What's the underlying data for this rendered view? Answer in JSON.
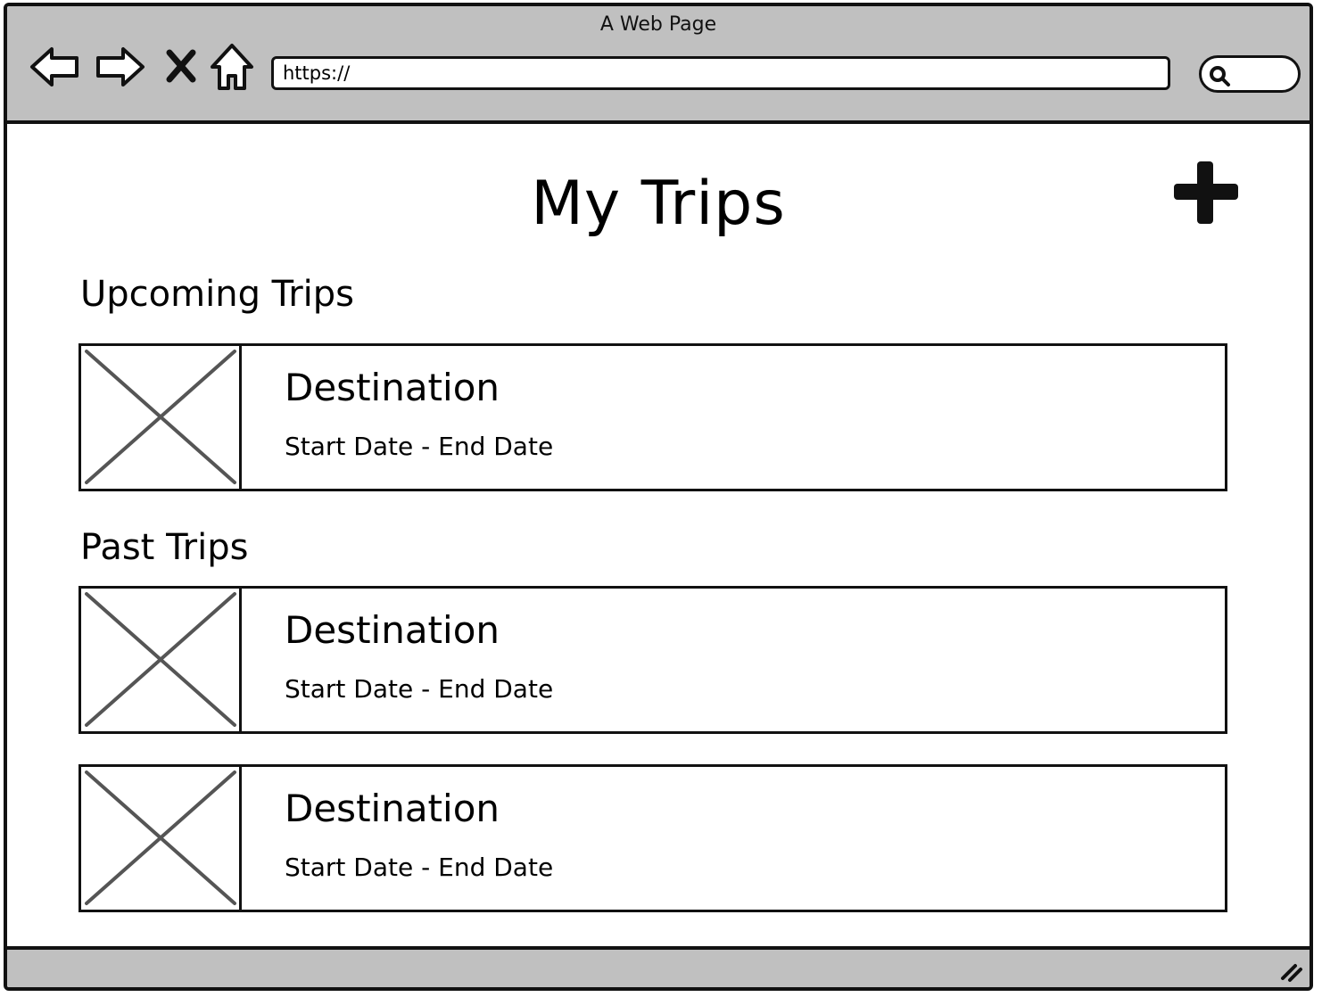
{
  "window": {
    "title": "A Web Page"
  },
  "browser": {
    "url": "https://",
    "icons": [
      "back-icon",
      "forward-icon",
      "close-icon",
      "home-icon",
      "search-icon"
    ]
  },
  "page": {
    "title": "My Trips",
    "add_icon": "plus-icon"
  },
  "sections": {
    "upcoming": {
      "heading": "Upcoming Trips",
      "trips": [
        {
          "destination": "Destination",
          "dates": "Start Date - End Date"
        }
      ]
    },
    "past": {
      "heading": "Past Trips",
      "trips": [
        {
          "destination": "Destination",
          "dates": "Start Date - End Date"
        },
        {
          "destination": "Destination",
          "dates": "Start Date - End Date"
        }
      ]
    }
  },
  "colors": {
    "chrome": "#c0c0c0",
    "ink": "#111111",
    "placeholder_x": "#555555"
  }
}
